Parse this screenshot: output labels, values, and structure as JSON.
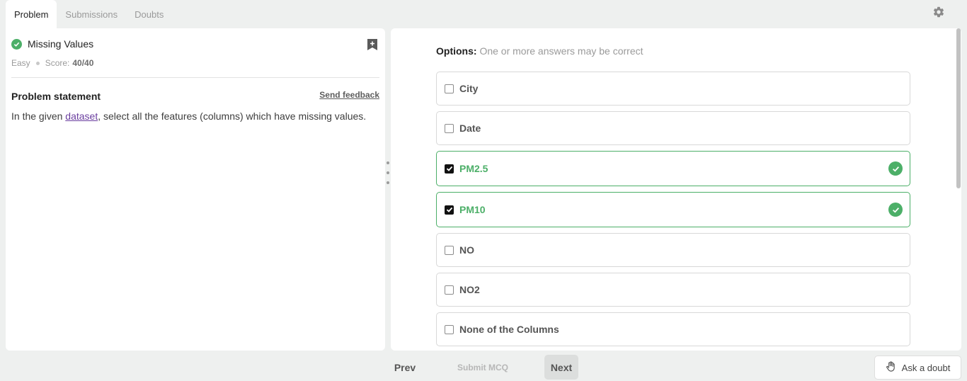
{
  "tabs": [
    {
      "label": "Problem",
      "active": true
    },
    {
      "label": "Submissions",
      "active": false
    },
    {
      "label": "Doubts",
      "active": false
    }
  ],
  "problem": {
    "title": "Missing Values",
    "status_icon": "check-circle-icon",
    "difficulty": "Easy",
    "score_label": "Score:",
    "score_value": "40/40",
    "statement_heading": "Problem statement",
    "feedback_label": "Send feedback",
    "statement_before": "In the given ",
    "statement_link": "dataset",
    "statement_after": ", select all the features (columns) which have missing values."
  },
  "options_header": {
    "label": "Options:",
    "hint": "One or more answers may be correct"
  },
  "options": [
    {
      "label": "City",
      "checked": false,
      "correct": false
    },
    {
      "label": "Date",
      "checked": false,
      "correct": false
    },
    {
      "label": "PM2.5",
      "checked": true,
      "correct": true
    },
    {
      "label": "PM10",
      "checked": true,
      "correct": true
    },
    {
      "label": "NO",
      "checked": false,
      "correct": false
    },
    {
      "label": "NO2",
      "checked": false,
      "correct": false
    },
    {
      "label": "None of the Columns",
      "checked": false,
      "correct": false
    }
  ],
  "footer": {
    "prev_label": "Prev",
    "submit_label": "Submit MCQ",
    "next_label": "Next",
    "doubt_label": "Ask a doubt"
  },
  "colors": {
    "correct": "#4caf68",
    "link": "#6b3fa0",
    "background": "#eef0ef"
  }
}
